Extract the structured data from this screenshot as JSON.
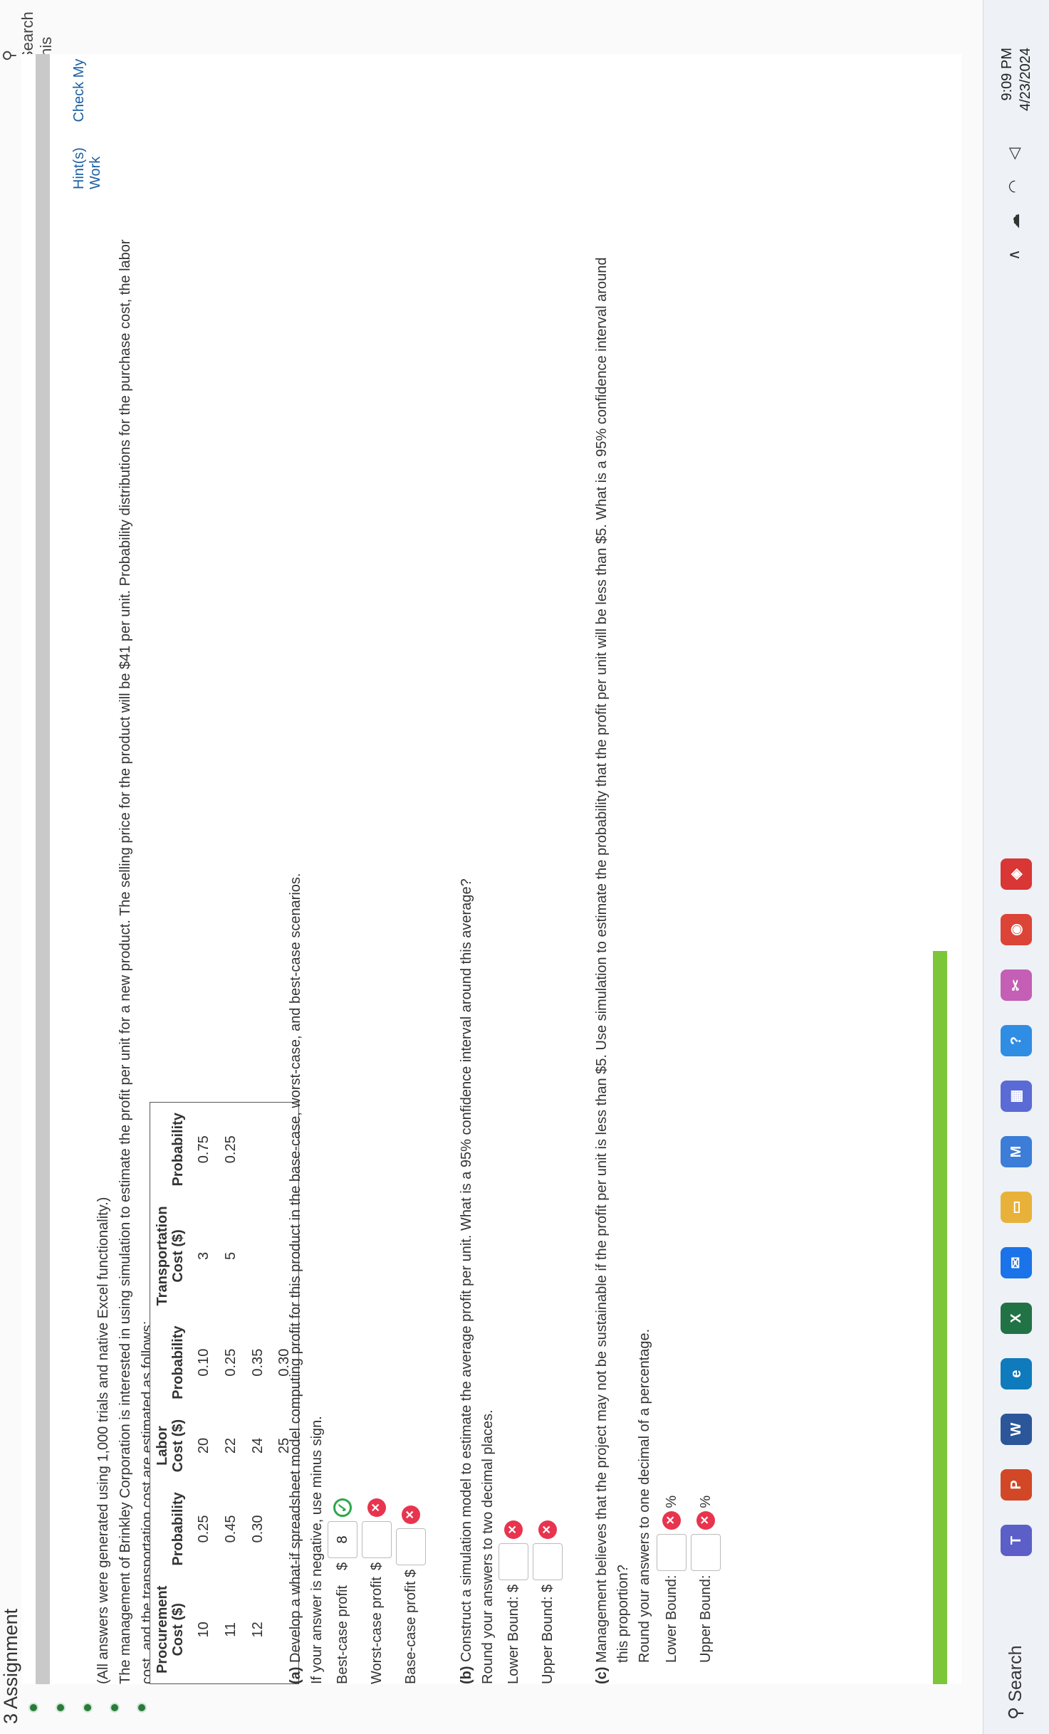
{
  "header": {
    "assignment_title": "3 Assignment",
    "search_text": "Search this"
  },
  "toolbar": {
    "hint_label": "Hint(s)",
    "check_label": "Check My Work"
  },
  "problem": {
    "note": "(All answers were generated using 1,000 trials and native Excel functionality.)",
    "intro_line1": "The management of Brinkley Corporation is interested in using simulation to estimate the profit per unit for a new product. The selling price for the product will be $41 per unit. Probability distributions for the purchase cost, the labor",
    "intro_line2": "cost, and the transportation cost are estimated as follows:"
  },
  "table": {
    "headers": [
      "Procurement Cost ($)",
      "Probability",
      "Labor Cost ($)",
      "Probability",
      "Transportation Cost ($)",
      "Probability"
    ],
    "header_lines": [
      [
        "Procurement",
        "Cost ($)"
      ],
      [
        "",
        "Probability"
      ],
      [
        "Labor",
        "Cost ($)"
      ],
      [
        "",
        "Probability"
      ],
      [
        "Transportation",
        "Cost ($)"
      ],
      [
        "",
        "Probability"
      ]
    ],
    "rows": [
      [
        "10",
        "0.25",
        "20",
        "0.10",
        "3",
        "0.75"
      ],
      [
        "11",
        "0.45",
        "22",
        "0.25",
        "5",
        "0.25"
      ],
      [
        "12",
        "0.30",
        "24",
        "0.35",
        "",
        ""
      ],
      [
        "",
        "",
        "25",
        "0.30",
        "",
        ""
      ]
    ]
  },
  "part_a": {
    "label": "(a)",
    "question": "Develop a what-if spreadsheet model computing profit for this product in the base-case, worst-case, and best-case scenarios.",
    "instruction": "If your answer is negative, use minus sign.",
    "best_label": "Best-case profit",
    "worst_label": "Worst-case profit",
    "base_label": "Base-case profit",
    "currency": "$",
    "best_value": "8",
    "worst_value": "",
    "base_value": ""
  },
  "part_b": {
    "label": "(b)",
    "question": "Construct a simulation model to estimate the average profit per unit. What is a 95% confidence interval around this average?",
    "instruction": "Round your answers to two decimal places.",
    "lower_label": "Lower Bound: $",
    "upper_label": "Upper Bound: $",
    "lower_value": "",
    "upper_value": ""
  },
  "part_c": {
    "label": "(c)",
    "question_line1": "Management believes that the project may not be sustainable if the profit per unit is less than $5. Use simulation to estimate the probability that the profit per unit will be less than $5. What is a 95% confidence interval around",
    "question_line2": "this proportion?",
    "instruction": "Round your answers to one decimal of a percentage.",
    "lower_label": "Lower Bound:",
    "upper_label": "Upper Bound:",
    "unit": "%",
    "lower_value": "",
    "upper_value": ""
  },
  "marks": {
    "correct": "✓",
    "wrong": "✕"
  },
  "taskbar": {
    "search_label": "Search",
    "time": "9:09 PM",
    "date": "4/23/2024",
    "apps": [
      {
        "icon": "teams-icon",
        "glyph": "T",
        "color": "#5b5fc7"
      },
      {
        "icon": "powerpoint-icon",
        "glyph": "P",
        "color": "#d24726"
      },
      {
        "icon": "word-icon",
        "glyph": "W",
        "color": "#2b579a"
      },
      {
        "icon": "edge-icon",
        "glyph": "e",
        "color": "#0f7bbd"
      },
      {
        "icon": "excel-icon",
        "glyph": "X",
        "color": "#217346"
      },
      {
        "icon": "mail-icon",
        "glyph": "✉",
        "color": "#1a73e8"
      },
      {
        "icon": "file-explorer-icon",
        "glyph": "▭",
        "color": "#e8b23a"
      },
      {
        "icon": "m-app-icon",
        "glyph": "M",
        "color": "#3b7dd8"
      },
      {
        "icon": "store-icon",
        "glyph": "▦",
        "color": "#5a6bd6"
      },
      {
        "icon": "help-icon",
        "glyph": "?",
        "color": "#2f8de4"
      },
      {
        "icon": "snip-icon",
        "glyph": "✂",
        "color": "#c45fb5"
      },
      {
        "icon": "chrome-icon",
        "glyph": "◉",
        "color": "#db4437"
      },
      {
        "icon": "security-icon",
        "glyph": "◈",
        "color": "#d93636"
      }
    ]
  }
}
